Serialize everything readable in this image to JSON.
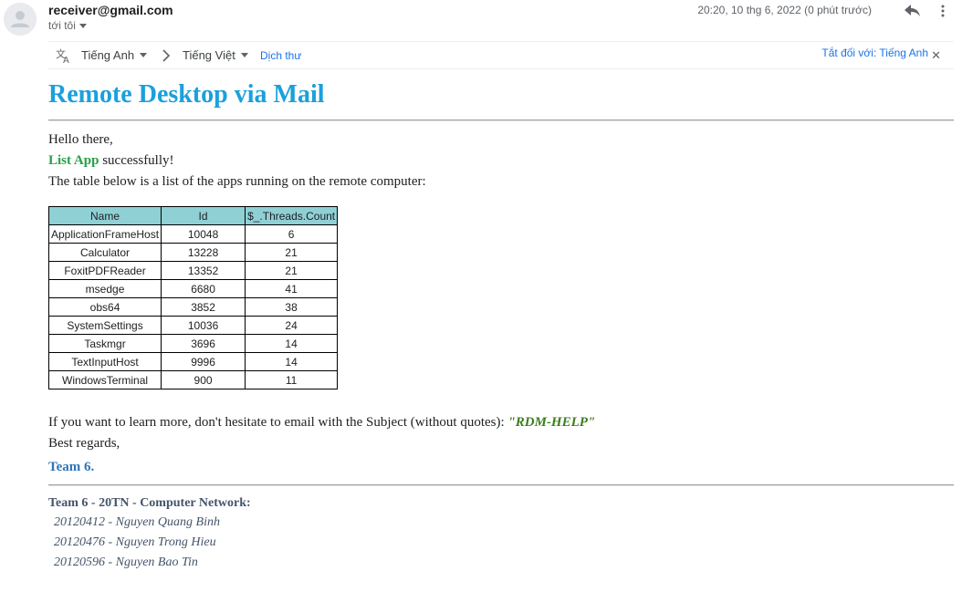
{
  "header": {
    "sender": "receiver@gmail.com",
    "to_label": "tới tôi",
    "date": "20:20, 10 thg 6, 2022 (0 phút trước)"
  },
  "translate_bar": {
    "source_lang": "Tiếng Anh",
    "target_lang": "Tiếng Việt",
    "translate_label": "Dịch thư",
    "turn_off_label": "Tắt đối với: Tiếng Anh"
  },
  "mail": {
    "title": "Remote Desktop via Mail",
    "greeting": "Hello there,",
    "action_name": "List App",
    "action_suffix": " successfully!",
    "intro": "The table below is a list of the apps running on the remote computer:",
    "table": {
      "headers": [
        "Name",
        "Id",
        "$_.Threads.Count"
      ],
      "rows": [
        [
          "ApplicationFrameHost",
          "10048",
          "6"
        ],
        [
          "Calculator",
          "13228",
          "21"
        ],
        [
          "FoxitPDFReader",
          "13352",
          "21"
        ],
        [
          "msedge",
          "6680",
          "41"
        ],
        [
          "obs64",
          "3852",
          "38"
        ],
        [
          "SystemSettings",
          "10036",
          "24"
        ],
        [
          "Taskmgr",
          "3696",
          "14"
        ],
        [
          "TextInputHost",
          "9996",
          "14"
        ],
        [
          "WindowsTerminal",
          "900",
          "11"
        ]
      ]
    },
    "learn_more": "If you want to learn more, don't hesitate to email with the Subject (without quotes): ",
    "help_subject": "\"RDM-HELP\"",
    "regards": "Best regards,",
    "team": "Team 6."
  },
  "signature": {
    "title": "Team 6 - 20TN - Computer Network:",
    "members": [
      "20120412 - Nguyen Quang Binh",
      "20120476 - Nguyen Trong Hieu",
      "20120596 - Nguyen Bao Tin"
    ]
  },
  "colors": {
    "title": "#1ba0dd",
    "action": "#25a244",
    "subject": "#3b7d1a",
    "team": "#2e75b6",
    "signature": "#44546a",
    "table_header_bg": "#8fd0d5",
    "link": "#1a73e8"
  },
  "icons": {
    "avatar": "person-icon",
    "reply": "reply-icon",
    "more": "more-vert-icon",
    "translate": "translate-icon",
    "arrow": "chevron-right-icon",
    "close": "close-icon"
  }
}
